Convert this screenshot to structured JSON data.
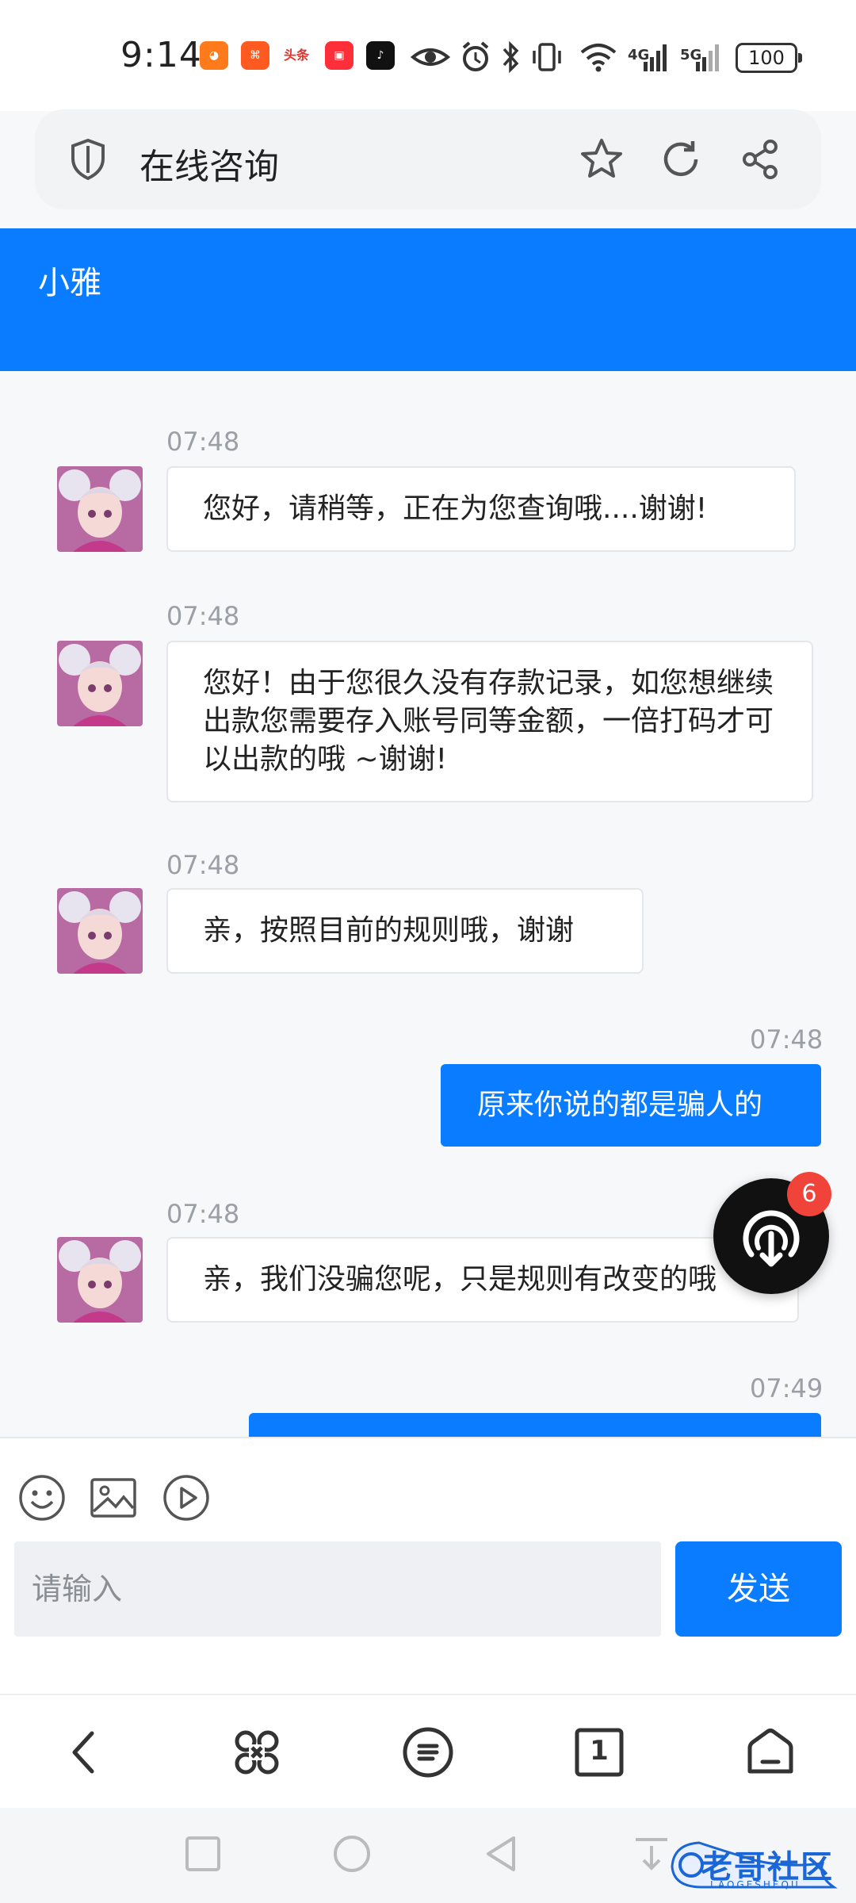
{
  "status_bar": {
    "time": "9:14",
    "app_icons": [
      "taobao-icon",
      "kuaishou-icon",
      "toutiao-icon",
      "red-app-icon",
      "douyin-icon"
    ],
    "indicators": [
      "eye-icon",
      "alarm-icon",
      "bluetooth-icon",
      "vibrate-icon",
      "wifi-icon"
    ],
    "network_1": "4G",
    "network_2": "5G",
    "battery": "100"
  },
  "browser": {
    "title": "在线咨询",
    "icons": [
      "shield-icon",
      "star-icon",
      "refresh-icon",
      "share-icon"
    ]
  },
  "chat": {
    "agent_name": "小雅",
    "messages": [
      {
        "side": "in",
        "time": "07:48",
        "text": "您好，请稍等，正在为您查询哦....谢谢!"
      },
      {
        "side": "in",
        "time": "07:48",
        "text": "您好！由于您很久没有存款记录，如您想继续出款您需要存入账号同等金额，一倍打码才可以出款的哦 ~谢谢!"
      },
      {
        "side": "in",
        "time": "07:48",
        "text": "亲，按照目前的规则哦，谢谢"
      },
      {
        "side": "out",
        "time": "07:48",
        "text": "原来你说的都是骗人的"
      },
      {
        "side": "in",
        "time": "07:48",
        "text": "亲，我们没骗您呢，只是规则有改变的哦"
      },
      {
        "side": "out",
        "time": "07:49",
        "text": ""
      }
    ]
  },
  "fab": {
    "badge": "6",
    "icon": "cloud-download-icon"
  },
  "input": {
    "placeholder": "请输入",
    "value": "",
    "send_label": "发送",
    "tools": [
      "emoji-icon",
      "image-icon",
      "video-icon"
    ]
  },
  "browser_nav": [
    "back-icon",
    "apps-icon",
    "menu-icon",
    "tabs-icon",
    "home-icon"
  ],
  "tabs_count": "1",
  "system_nav": [
    "recents-icon",
    "home-circle-icon",
    "back-triangle-icon"
  ],
  "watermark": {
    "text": "老哥社区",
    "sub": "LAOGESHEQU"
  },
  "colors": {
    "accent": "#0a7cff",
    "badge": "#f0443a",
    "fab": "#111111"
  }
}
